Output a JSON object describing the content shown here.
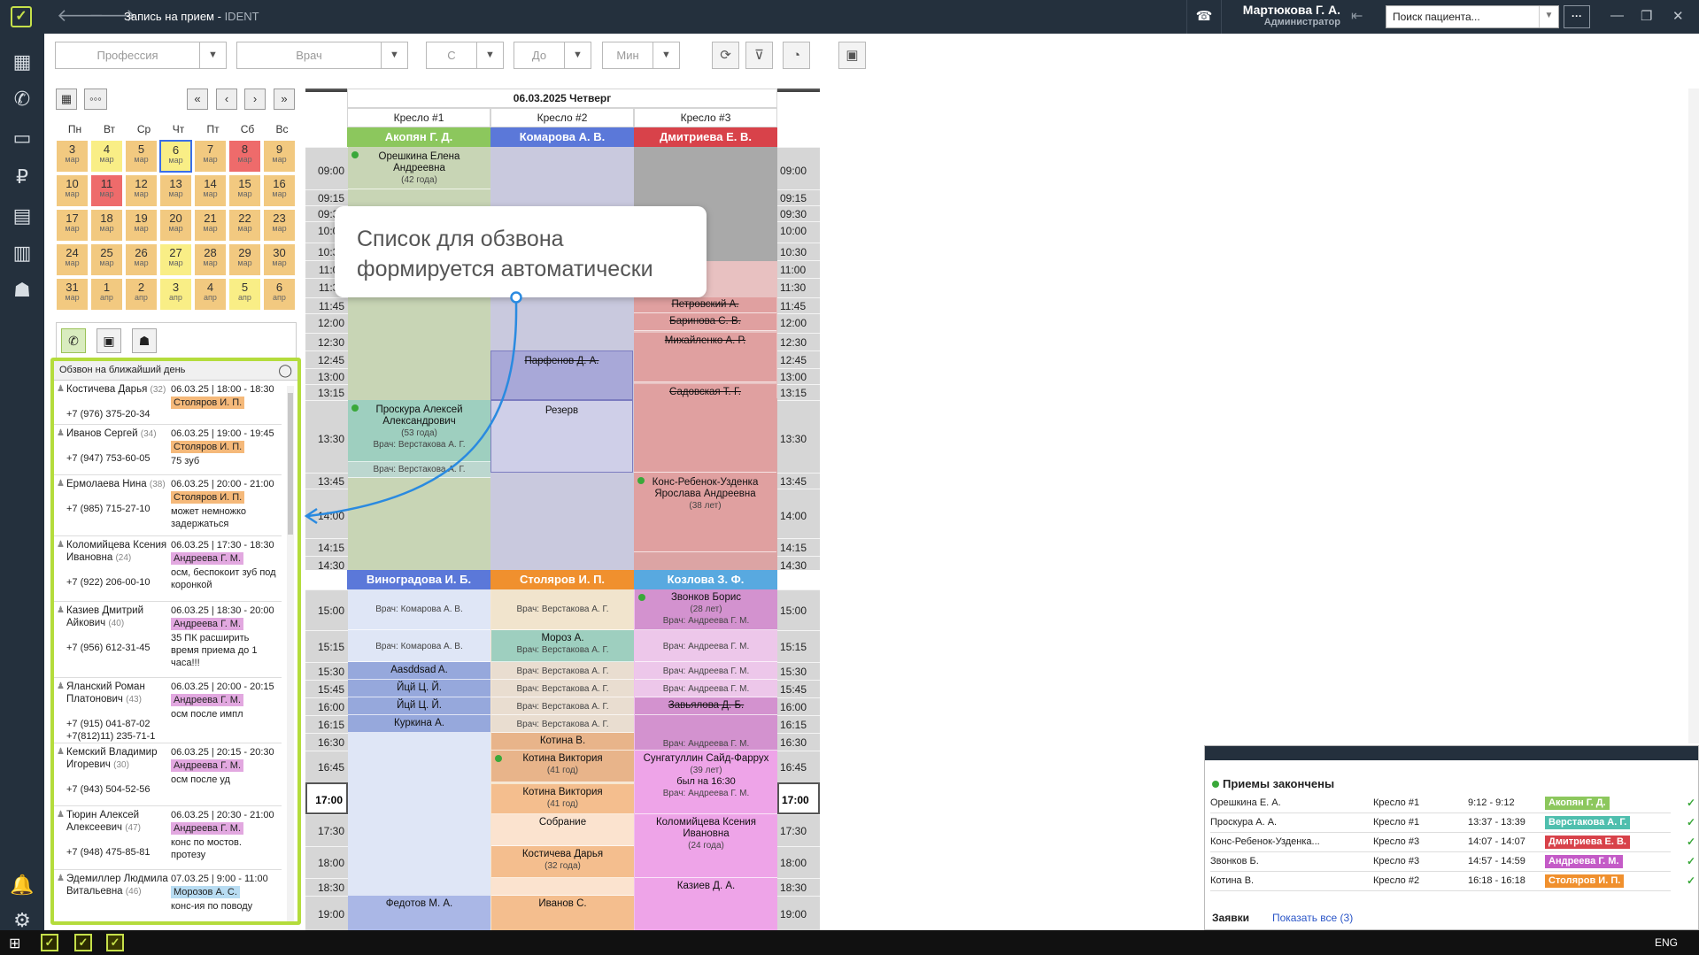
{
  "window": {
    "title": "Запись на прием",
    "app": "IDENT",
    "user_name": "Мартюкова Г. А.",
    "user_role": "Администратор",
    "search_placeholder": "Поиск пациента..."
  },
  "filters": {
    "profession": "Профессия",
    "doctor": "Врач",
    "from": "С",
    "to": "До",
    "min": "Мин"
  },
  "calendar": {
    "weekdays": [
      "Пн",
      "Вт",
      "Ср",
      "Чт",
      "Пт",
      "Сб",
      "Вс"
    ],
    "weeks": [
      [
        {
          "d": "3",
          "m": "мар",
          "c": "wk"
        },
        {
          "d": "4",
          "m": "мар",
          "c": "yl"
        },
        {
          "d": "5",
          "m": "мар",
          "c": "wk"
        },
        {
          "d": "6",
          "m": "мар",
          "c": "yl",
          "today": true
        },
        {
          "d": "7",
          "m": "мар",
          "c": "wk"
        },
        {
          "d": "8",
          "m": "мар",
          "c": "rd"
        },
        {
          "d": "9",
          "m": "мар",
          "c": "wk"
        }
      ],
      [
        {
          "d": "10",
          "m": "мар",
          "c": "wk"
        },
        {
          "d": "11",
          "m": "мар",
          "c": "rd"
        },
        {
          "d": "12",
          "m": "мар",
          "c": "wk"
        },
        {
          "d": "13",
          "m": "мар",
          "c": "wk"
        },
        {
          "d": "14",
          "m": "мар",
          "c": "wk"
        },
        {
          "d": "15",
          "m": "мар",
          "c": "wk"
        },
        {
          "d": "16",
          "m": "мар",
          "c": "wk"
        }
      ],
      [
        {
          "d": "17",
          "m": "мар",
          "c": "wk"
        },
        {
          "d": "18",
          "m": "мар",
          "c": "wk"
        },
        {
          "d": "19",
          "m": "мар",
          "c": "wk"
        },
        {
          "d": "20",
          "m": "мар",
          "c": "wk"
        },
        {
          "d": "21",
          "m": "мар",
          "c": "wk"
        },
        {
          "d": "22",
          "m": "мар",
          "c": "wk"
        },
        {
          "d": "23",
          "m": "мар",
          "c": "wk"
        }
      ],
      [
        {
          "d": "24",
          "m": "мар",
          "c": "wk"
        },
        {
          "d": "25",
          "m": "мар",
          "c": "wk"
        },
        {
          "d": "26",
          "m": "мар",
          "c": "wk"
        },
        {
          "d": "27",
          "m": "мар",
          "c": "yl"
        },
        {
          "d": "28",
          "m": "мар",
          "c": "wk"
        },
        {
          "d": "29",
          "m": "мар",
          "c": "wk"
        },
        {
          "d": "30",
          "m": "мар",
          "c": "wk"
        }
      ],
      [
        {
          "d": "31",
          "m": "мар",
          "c": "wk"
        },
        {
          "d": "1",
          "m": "апр",
          "c": "wk"
        },
        {
          "d": "2",
          "m": "апр",
          "c": "wk"
        },
        {
          "d": "3",
          "m": "апр",
          "c": "yl"
        },
        {
          "d": "4",
          "m": "апр",
          "c": "wk"
        },
        {
          "d": "5",
          "m": "апр",
          "c": "yl"
        },
        {
          "d": "6",
          "m": "апр",
          "c": "wk"
        }
      ]
    ]
  },
  "calllist": {
    "title": "Обзвон на ближайший день",
    "rows": [
      {
        "name": "Костичева Дарья",
        "age": "(32)",
        "phone": "+7 (976) 375-20-34",
        "date": "06.03.25 | 18:00 - 18:30",
        "doctor": "Столяров И. П.",
        "color": "#f5b97a",
        "note": ""
      },
      {
        "name": "Иванов Сергей",
        "age": "(34)",
        "phone": "+7 (947) 753-60-05",
        "date": "06.03.25 | 19:00 - 19:45",
        "doctor": "Столяров И. П.",
        "color": "#f5b97a",
        "note": "75 зуб"
      },
      {
        "name": "Ермолаева Нина",
        "age": "(38)",
        "phone": "+7 (985) 715-27-10",
        "date": "06.03.25 | 20:00 - 21:00",
        "doctor": "Столяров И. П.",
        "color": "#f5b97a",
        "note": "может немножко задержаться"
      },
      {
        "name": "Коломийцева Ксения Ивановна",
        "age": "(24)",
        "phone": "+7 (922) 206-00-10",
        "date": "06.03.25 | 17:30 - 18:30",
        "doctor": "Андреева Г. М.",
        "color": "#e2a8e0",
        "note": "осм, беспокоит зуб под коронкой"
      },
      {
        "name": "Казиев Дмитрий Айкович",
        "age": "(40)",
        "phone": "+7 (956) 612-31-45",
        "date": "06.03.25 | 18:30 - 20:00",
        "doctor": "Андреева Г. М.",
        "color": "#e2a8e0",
        "note": "35 ПК расширить время приема до 1 часа!!!"
      },
      {
        "name": "Яланский Роман Платонович",
        "age": "(43)",
        "phone": "+7 (915) 041-87-02",
        "phone2": "+7(812)11) 235-71-1",
        "date": "06.03.25 | 20:00 - 20:15",
        "doctor": "Андреева Г. М.",
        "color": "#e2a8e0",
        "note": "осм после импл"
      },
      {
        "name": "Кемский Владимир Игоревич",
        "age": "(30)",
        "phone": "+7 (943) 504-52-56",
        "date": "06.03.25 | 20:15 - 20:30",
        "doctor": "Андреева Г. М.",
        "color": "#e2a8e0",
        "note": "осм после уд"
      },
      {
        "name": "Тюрин Алексей Алексеевич",
        "age": "(47)",
        "phone": "+7 (948) 475-85-81",
        "date": "06.03.25 | 20:30 - 21:00",
        "doctor": "Андреева Г. М.",
        "color": "#e2a8e0",
        "note": "конс по мостов. протезу"
      },
      {
        "name": "Эдемиллер Людмила Витальевна",
        "age": "(46)",
        "phone": "",
        "date": "07.03.25 | 9:00 - 11:00",
        "doctor": "Морозов А. С.",
        "color": "#b8dcf2",
        "note": "конс-ия по поводу"
      }
    ]
  },
  "schedule": {
    "date": "06.03.2025 Четверг",
    "chairs": [
      "Кресло #1",
      "Кресло #2",
      "Кресло #3"
    ],
    "doctors_top": [
      {
        "name": "Акопян Г. Д.",
        "color": "#8cc75d"
      },
      {
        "name": "Комарова А. В.",
        "color": "#5b78d9"
      },
      {
        "name": "Дмитриева Е. В.",
        "color": "#d8424a"
      }
    ],
    "doctors_bottom": [
      {
        "name": "Виноградова И. Б.",
        "color": "#5b78d9"
      },
      {
        "name": "Столяров И. П.",
        "color": "#f0902e"
      },
      {
        "name": "Козлова З. Ф.",
        "color": "#58a9e0"
      }
    ],
    "times_top": [
      "09:00",
      "09:15",
      "09:30",
      "10:00",
      "10:30",
      "11:00",
      "11:30",
      "11:45",
      "12:00",
      "12:30",
      "12:45",
      "13:00",
      "13:15",
      "13:30",
      "13:45",
      "14:00",
      "14:15",
      "14:30"
    ],
    "times_bottom": [
      "15:00",
      "15:15",
      "15:30",
      "15:45",
      "16:00",
      "16:15",
      "16:30",
      "16:45",
      "17:00",
      "17:30",
      "18:00",
      "18:30",
      "19:00"
    ],
    "appts": {
      "a1": "Орешкина Елена Андреевна",
      "a1s": "(42 года)",
      "a2": "Проскура Алексей Александрович",
      "a2s": "(53 года)",
      "vrach_vers": "Врач: Верстакова А. Г.",
      "b1": "Парфенов Д. А.",
      "b2": "Резерв",
      "c1": "Петровский А.",
      "c2": "Баринова С. В.",
      "c3": "Михайленко А. Р.",
      "c4": "Садовская Т. Г.",
      "c5": "Конс-Ребенок-Узденка Ярослава Андреевна",
      "c5s": "(38 лет)",
      "vrach_kom": "Врач: Комарова А. В.",
      "vrach_andr": "Врач: Андреева Г. М.",
      "d1": "Aasddsad A.",
      "d2": "Йцй Ц. Й.",
      "d3": "Йцй Ц. Й.",
      "d4": "Куркина А.",
      "d5": "Федотов М. А.",
      "e1": "Мороз А.",
      "e2": "Котина В.",
      "e3": "Котина Виктория",
      "e3s": "(41 год)",
      "e4": "Котина Виктория",
      "e4s": "(41 год)",
      "e5": "Собрание",
      "e6": "Костичева Дарья",
      "e6s": "(32 года)",
      "e7": "Иванов С.",
      "f1": "Звонков Борис",
      "f1s": "(28 лет)",
      "f2": "Завьялова Д. Б.",
      "f3": "Сунгатуллин Сайд-Фаррух",
      "f3s": "(39 лет)",
      "f3n": "был на 16:30",
      "f4": "Коломийцева Ксения Ивановна",
      "f4s": "(24 года)",
      "f5": "Казиев Д. А."
    }
  },
  "bubble": {
    "text_line1": "Список для обзвона",
    "text_line2": "формируется автоматически"
  },
  "completed": {
    "title": "Приемы закончены",
    "rows": [
      {
        "patient": "Орешкина Е. А.",
        "chair": "Кресло #1",
        "time": "9:12 - 9:12",
        "doctor": "Акопян Г. Д.",
        "color": "#8cc75d"
      },
      {
        "patient": "Проскура А. А.",
        "chair": "Кресло #1",
        "time": "13:37 - 13:39",
        "doctor": "Верстакова А. Г.",
        "color": "#4fbfae"
      },
      {
        "patient": "Конс-Ребенок-Узденка...",
        "chair": "Кресло #3",
        "time": "14:07 - 14:07",
        "doctor": "Дмитриева Е. В.",
        "color": "#d8424a"
      },
      {
        "patient": "Звонков Б.",
        "chair": "Кресло #3",
        "time": "14:57 - 14:59",
        "doctor": "Андреева Г. М.",
        "color": "#c45bc7"
      },
      {
        "patient": "Котина В.",
        "chair": "Кресло #2",
        "time": "16:18 - 16:18",
        "doctor": "Столяров И. П.",
        "color": "#f0902e"
      }
    ],
    "requests_label": "Заявки",
    "show_all": "Показать все (3)"
  },
  "taskbar": {
    "lang": "ENG"
  }
}
